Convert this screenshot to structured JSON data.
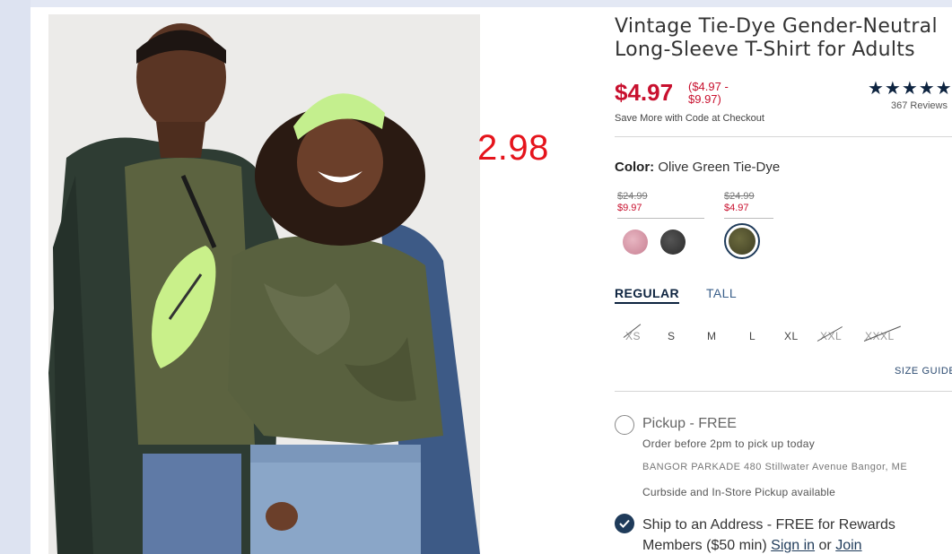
{
  "product": {
    "title_line1": "Vintage Tie-Dye Gender-Neutral",
    "title_line2": "Long-Sleeve T-Shirt for Adults",
    "price": "$4.97",
    "price_range": "($4.97 - $9.97)",
    "rating_stars": "★★★★★",
    "reviews": "367 Reviews",
    "promo": "Save More with Code at Checkout"
  },
  "annotation": "2.98",
  "color": {
    "label": "Color:",
    "value": "Olive Green Tie-Dye",
    "price_groups": [
      {
        "old": "$24.99",
        "new": "$9.97"
      },
      {
        "old": "$24.99",
        "new": "$4.97"
      }
    ],
    "swatches": [
      {
        "name": "pink-tie-dye",
        "color": "#d69aa9",
        "selected": false
      },
      {
        "name": "black-tie-dye",
        "color": "#3a3a3a",
        "selected": false
      },
      {
        "name": "olive-green-tie-dye",
        "color": "#565532",
        "selected": true
      }
    ]
  },
  "fit_tabs": {
    "regular": "REGULAR",
    "tall": "TALL",
    "selected": "REGULAR"
  },
  "sizes": [
    {
      "label": "XS",
      "available": false
    },
    {
      "label": "S",
      "available": true
    },
    {
      "label": "M",
      "available": true
    },
    {
      "label": "L",
      "available": true
    },
    {
      "label": "XL",
      "available": true
    },
    {
      "label": "XXL",
      "available": false
    },
    {
      "label": "XXXL",
      "available": false
    }
  ],
  "size_guide": "SIZE GUIDE",
  "fulfillment": {
    "pickup_label": "Pickup - FREE",
    "pickup_note": "Order before 2pm to pick up today",
    "store": "BANGOR PARKADE 480 Stillwater Avenue Bangor, ME",
    "curbside": "Curbside and In-Store Pickup available",
    "ship_text_1": "Ship to an Address - FREE for Rewards",
    "ship_text_2": "Members ($50 min)",
    "sign_in": "Sign in",
    "or": "or",
    "join": "Join"
  },
  "colors": {
    "sale_red": "#c8102e",
    "navy": "#0e2440",
    "annotation_red": "#e5141c"
  }
}
